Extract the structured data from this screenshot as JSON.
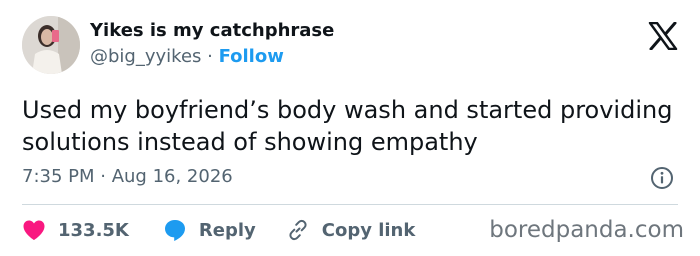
{
  "author": {
    "display_name": "Yikes is my catchphrase",
    "handle": "@big_yyikes",
    "separator": " · ",
    "follow_label": "Follow"
  },
  "tweet": {
    "text": "Used my boyfriend’s body wash and started providing solutions instead of showing empathy",
    "time": "7:35 PM",
    "date": "Aug 16, 2026",
    "time_separator": " · "
  },
  "actions": {
    "like_count": "133.5K",
    "reply_label": "Reply",
    "copy_link_label": "Copy link"
  },
  "watermark": "boredpanda.com",
  "icons": {
    "like": "heart-icon",
    "reply": "speech-bubble-icon",
    "copy": "link-icon",
    "info": "info-icon",
    "platform": "x-logo-icon"
  },
  "colors": {
    "like": "#f91880",
    "reply": "#1d9bf0",
    "follow": "#1d9bf0",
    "muted": "#536471",
    "text": "#0f1419"
  }
}
